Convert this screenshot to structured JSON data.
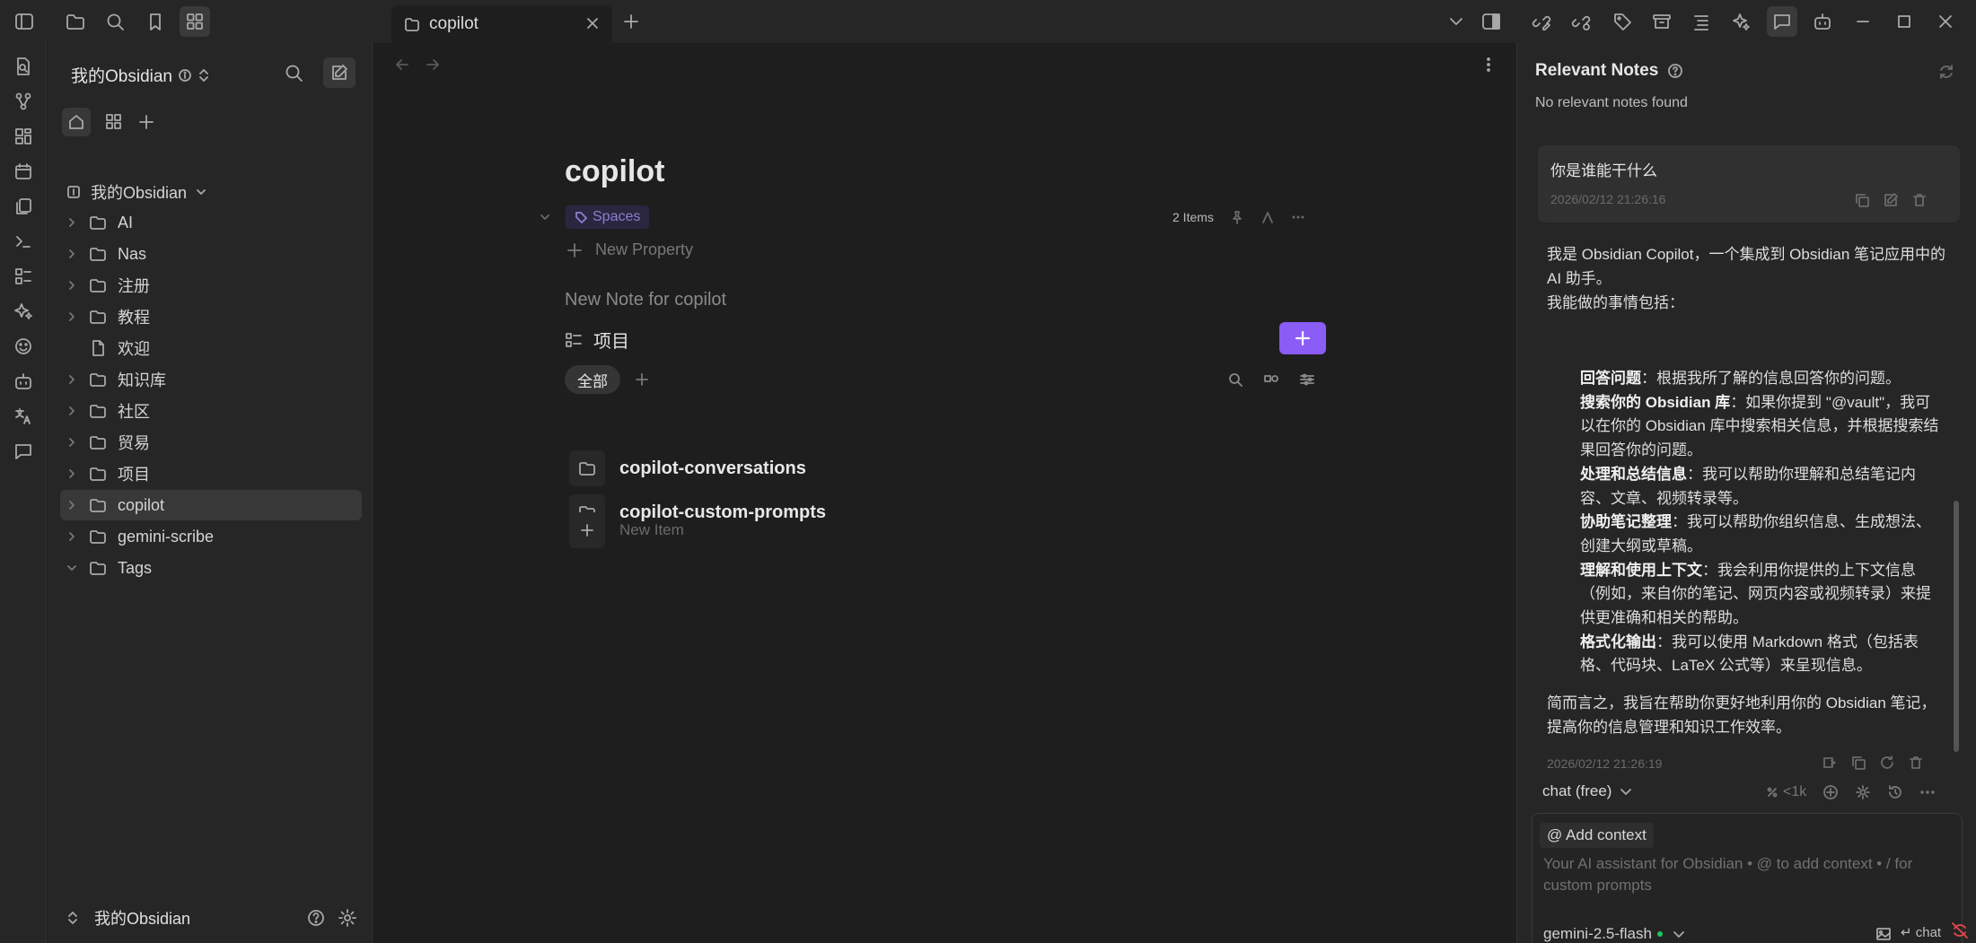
{
  "tab": {
    "title": "copilot"
  },
  "vault": {
    "name": "我的Obsidian",
    "root": "我的Obsidian"
  },
  "tree": [
    {
      "label": "AI",
      "type": "folder",
      "expanded": false
    },
    {
      "label": "Nas",
      "type": "folder",
      "expanded": false
    },
    {
      "label": "注册",
      "type": "folder",
      "expanded": false
    },
    {
      "label": "教程",
      "type": "folder",
      "expanded": false
    },
    {
      "label": "欢迎",
      "type": "file"
    },
    {
      "label": "知识库",
      "type": "folder",
      "expanded": false
    },
    {
      "label": "社区",
      "type": "folder",
      "expanded": false
    },
    {
      "label": "贸易",
      "type": "folder",
      "expanded": false
    },
    {
      "label": "项目",
      "type": "folder",
      "expanded": false
    },
    {
      "label": "copilot",
      "type": "folder",
      "expanded": false,
      "active": true
    },
    {
      "label": "gemini-scribe",
      "type": "folder",
      "expanded": false
    },
    {
      "label": "Tags",
      "type": "folder",
      "expanded": true
    }
  ],
  "note": {
    "title": "copilot",
    "tag": "Spaces",
    "items_count": "2 Items",
    "new_property": "New Property",
    "new_note_placeholder": "New Note for copilot",
    "section_title": "项目",
    "filter_all": "全部",
    "items": [
      "copilot-conversations",
      "copilot-custom-prompts"
    ],
    "new_item": "New Item"
  },
  "relevant": {
    "title": "Relevant Notes",
    "empty": "No relevant notes found"
  },
  "chat": {
    "user_message": "你是谁能干什么",
    "user_time": "2026/02/12 21:26:16",
    "ai_intro_1": "我是 Obsidian Copilot，一个集成到 Obsidian 笔记应用中的 AI 助手。",
    "ai_intro_2": "我能做的事情包括：",
    "ai_points": [
      {
        "bold": "回答问题",
        "text": "：根据我所了解的信息回答你的问题。"
      },
      {
        "bold": "搜索你的 Obsidian 库",
        "text": "：如果你提到 \"@vault\"，我可以在你的 Obsidian 库中搜索相关信息，并根据搜索结果回答你的问题。"
      },
      {
        "bold": "处理和总结信息",
        "text": "：我可以帮助你理解和总结笔记内容、文章、视频转录等。"
      },
      {
        "bold": "协助笔记整理",
        "text": "：我可以帮助你组织信息、生成想法、创建大纲或草稿。"
      },
      {
        "bold": "理解和使用上下文",
        "text": "：我会利用你提供的上下文信息（例如，来自你的笔记、网页内容或视频转录）来提供更准确和相关的帮助。"
      },
      {
        "bold": "格式化输出",
        "text": "：我可以使用 Markdown 格式（包括表格、代码块、LaTeX 公式等）来呈现信息。"
      }
    ],
    "ai_summary": "简而言之，我旨在帮助你更好地利用你的 Obsidian 笔记，提高你的信息管理和知识工作效率。",
    "ai_time": "2026/02/12 21:26:19",
    "mode": "chat (free)",
    "token_count": "<1k",
    "add_context": "@ Add context",
    "input_placeholder": "Your AI assistant for Obsidian • @ to add context • / for custom prompts",
    "model": "gemini-2.5-flash",
    "send_label": "↵ chat"
  }
}
